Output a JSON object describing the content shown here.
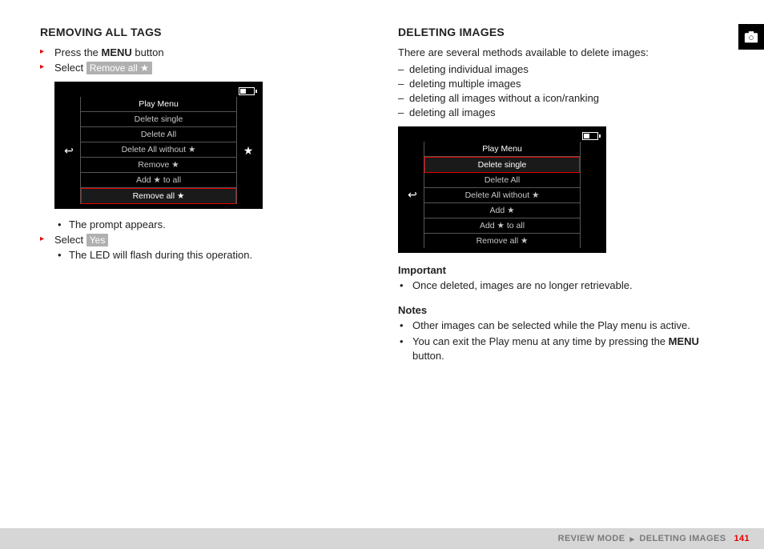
{
  "left": {
    "heading": "REMOVING ALL TAGS",
    "step1_pre": "Press the ",
    "step1_bold": "MENU",
    "step1_post": " button",
    "step2_pre": "Select ",
    "step2_chip": "Remove all ★",
    "screen": {
      "header": "Play Menu",
      "items": [
        "Delete single",
        "Delete All",
        "Delete All without ★",
        "Remove ★",
        "Add ★ to all",
        "Remove all ★"
      ],
      "selected_index": 5
    },
    "sub1": "The prompt appears.",
    "step3_pre": "Select ",
    "step3_chip": "Yes",
    "sub2": "The LED will flash during this operation."
  },
  "right": {
    "heading": "DELETING IMAGES",
    "intro": "There are several methods available to delete images:",
    "dashes": [
      "deleting individual images",
      "deleting multiple images",
      "deleting all images without a icon/ranking",
      "deleting all images"
    ],
    "screen": {
      "header": "Play Menu",
      "items": [
        "Delete single",
        "Delete All",
        "Delete All without ★",
        "Add ★",
        "Add ★ to all",
        "Remove all ★"
      ],
      "selected_index": 0
    },
    "important_label": "Important",
    "important_b1": "Once deleted, images are no longer retrievable.",
    "notes_label": "Notes",
    "notes_b1": "Other images can be selected while the Play menu is active.",
    "notes_b2_pre": "You can exit the Play menu at any time by pressing the ",
    "notes_b2_bold": "MENU",
    "notes_b2_post": " button."
  },
  "footer": {
    "crumb1": "REVIEW MODE",
    "crumb2": "DELETING IMAGES",
    "page": "141"
  }
}
